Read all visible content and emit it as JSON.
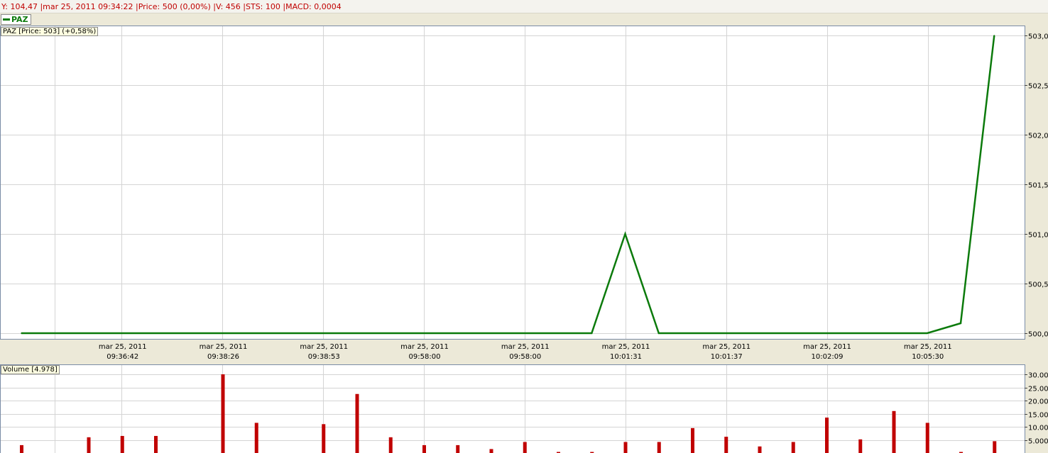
{
  "status_line": "Y: 104,47 |mar 25, 2011 09:34:22 |Price: 500 (0,00%) |V: 456 |STS: 100 |MACD: 0,0004",
  "legend": {
    "label": "PAZ",
    "color": "#0b7a0b"
  },
  "price_panel": {
    "tag": "PAZ [Price: 503] (+0,58%)"
  },
  "volume_panel": {
    "tag": "Volume [4.978]"
  },
  "colors": {
    "price_line": "#0b7a0b",
    "volume_bar": "#c00000",
    "grid": "#d4d4d4",
    "panel_bg": "#ffffff",
    "border": "#7a8ca6"
  },
  "chart_data": [
    {
      "type": "line",
      "series": [
        {
          "name": "PAZ",
          "x_index": [
            0,
            16,
            17,
            18,
            19,
            27,
            28,
            29
          ],
          "values": [
            500,
            500,
            500,
            501,
            500,
            500,
            500.1,
            503
          ]
        }
      ],
      "x_tick_labels": [
        {
          "index": 3,
          "date": "mar 25, 2011",
          "time": "09:36:42"
        },
        {
          "index": 6,
          "date": "mar 25, 2011",
          "time": "09:38:26"
        },
        {
          "index": 9,
          "date": "mar 25, 2011",
          "time": "09:38:53"
        },
        {
          "index": 12,
          "date": "mar 25, 2011",
          "time": "09:58:00"
        },
        {
          "index": 15,
          "date": "mar 25, 2011",
          "time": "09:58:00"
        },
        {
          "index": 18,
          "date": "mar 25, 2011",
          "time": "10:01:31"
        },
        {
          "index": 21,
          "date": "mar 25, 2011",
          "time": "10:01:37"
        },
        {
          "index": 24,
          "date": "mar 25, 2011",
          "time": "10:02:09"
        },
        {
          "index": 27,
          "date": "mar 25, 2011",
          "time": "10:05:30"
        }
      ],
      "y_ticks": [
        "500,0",
        "500,5",
        "501,0",
        "501,5",
        "502,0",
        "502,5",
        "503,0"
      ],
      "ylim": [
        500,
        503
      ],
      "grid": true
    },
    {
      "type": "bar",
      "series": [
        {
          "name": "Volume",
          "x_index": [
            0,
            2,
            3,
            4,
            6,
            7,
            9,
            10,
            11,
            12,
            13,
            14,
            15,
            16,
            17,
            18,
            19,
            20,
            21,
            22,
            23,
            24,
            25,
            26,
            27,
            28,
            29
          ],
          "values": [
            3000,
            6000,
            6500,
            6500,
            30000,
            11500,
            11000,
            22500,
            6000,
            3000,
            3000,
            1500,
            4200,
            400,
            400,
            4200,
            4200,
            9500,
            6200,
            2500,
            4200,
            13500,
            5200,
            16000,
            11500,
            400,
            4500
          ]
        }
      ],
      "y_ticks": [
        "5.000",
        "10.00",
        "15.00",
        "20.00",
        "25.00",
        "30.00"
      ],
      "ylim": [
        0,
        30000
      ],
      "grid": true
    }
  ]
}
